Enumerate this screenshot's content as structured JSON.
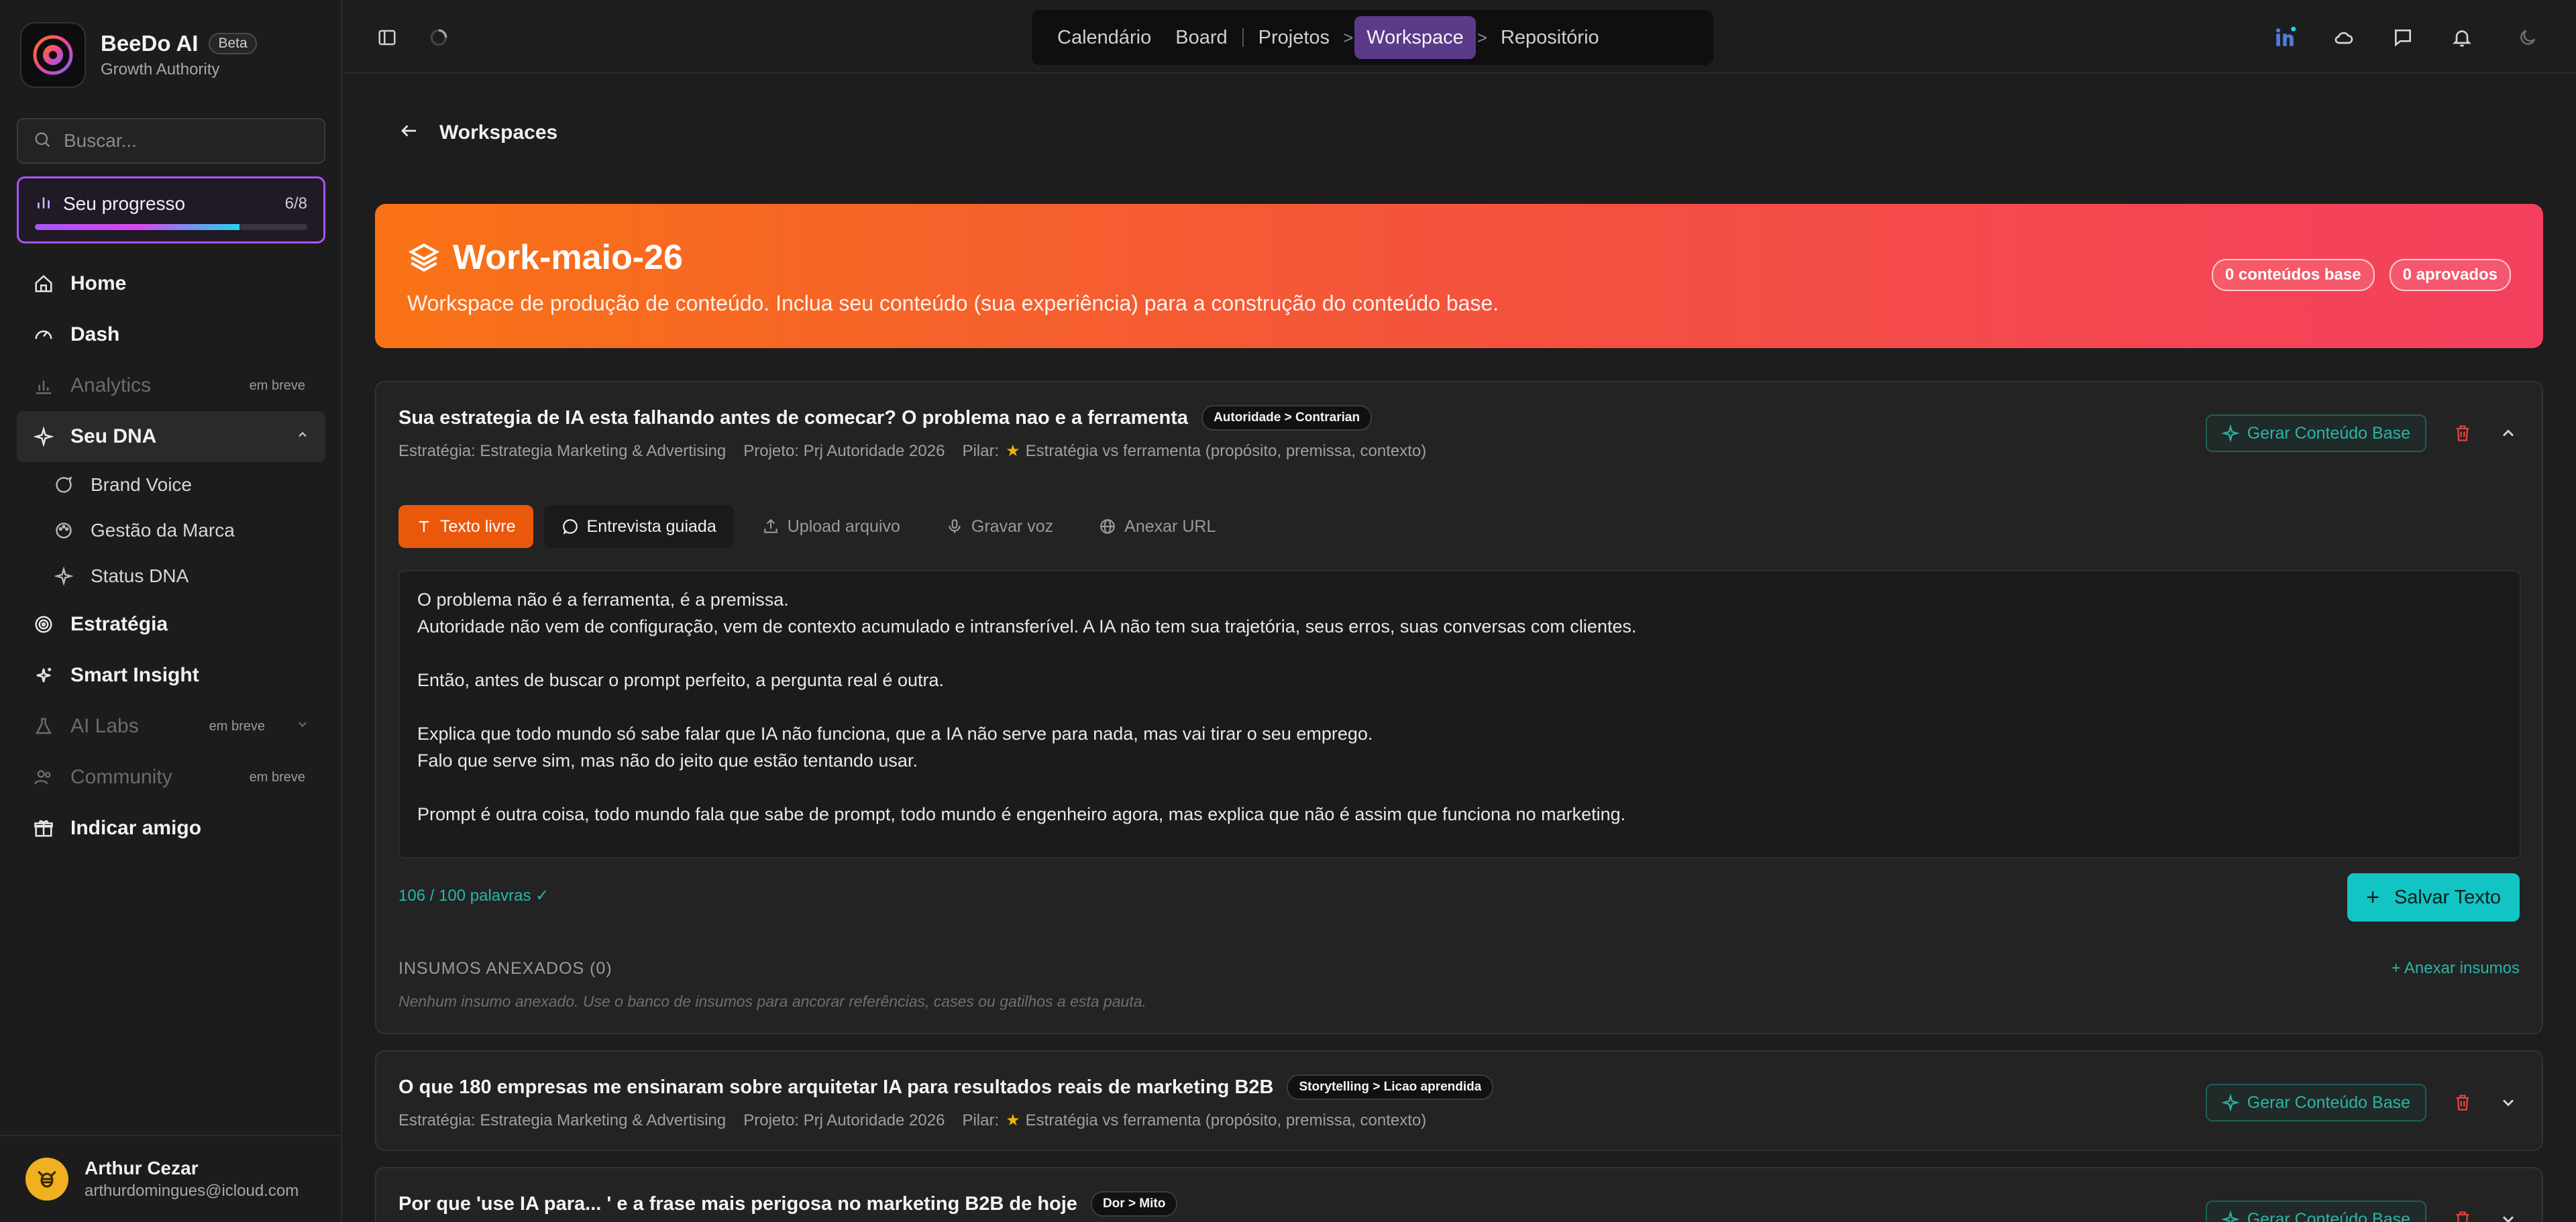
{
  "brand": {
    "name": "BeeDo AI",
    "badge": "Beta",
    "subtitle": "Growth Authority"
  },
  "search": {
    "placeholder": "Buscar..."
  },
  "progress": {
    "label": "Seu progresso",
    "count": "6/8",
    "value": 0.75
  },
  "nav": {
    "home": "Home",
    "dash": "Dash",
    "analytics": "Analytics",
    "analytics_soon": "em breve",
    "dna": "Seu DNA",
    "dna_items": [
      "Brand Voice",
      "Gestão da Marca",
      "Status DNA"
    ],
    "estrategia": "Estratégia",
    "smart_insight": "Smart Insight",
    "ai_labs": "AI Labs",
    "ai_labs_soon": "em breve",
    "community": "Community",
    "community_soon": "em breve",
    "indicar": "Indicar amigo"
  },
  "user": {
    "name": "Arthur Cezar",
    "email": "arthurdomingues@icloud.com"
  },
  "topnav": {
    "calendario": "Calendário",
    "board": "Board",
    "projetos": "Projetos",
    "workspace": "Workspace",
    "repositorio": "Repositório",
    "sep": ">"
  },
  "page": {
    "back_title": "Workspaces"
  },
  "hero": {
    "title": "Work-maio-26",
    "subtitle": "Workspace de produção de conteúdo. Inclua seu conteúdo (sua experiência) para a construção do conteúdo base.",
    "pill1": "0 conteúdos base",
    "pill2": "0 aprovados"
  },
  "cards": [
    {
      "title": "Sua estrategia de IA esta falhando antes de comecar? O problema nao e a ferramenta",
      "tag": "Autoridade > Contrarian",
      "estrategia": "Estratégia: Estrategia Marketing & Advertising",
      "projeto": "Projeto: Prj Autoridade 2026",
      "pilar_label": "Pilar:",
      "pilar": "Estratégia vs ferramenta (propósito, premissa, contexto)",
      "generate": "Gerar Conteúdo Base"
    },
    {
      "title": "O que 180 empresas me ensinaram sobre arquitetar IA para resultados reais de marketing B2B",
      "tag": "Storytelling > Licao aprendida",
      "estrategia": "Estratégia: Estrategia Marketing & Advertising",
      "projeto": "Projeto: Prj Autoridade 2026",
      "pilar_label": "Pilar:",
      "pilar": "Estratégia vs ferramenta (propósito, premissa, contexto)",
      "generate": "Gerar Conteúdo Base"
    },
    {
      "title": "Por que 'use IA para... ' e a frase mais perigosa no marketing B2B de hoje",
      "tag": "Dor > Mito",
      "generate": "Gerar Conteúdo Base"
    }
  ],
  "editor": {
    "tabs": [
      "Texto livre",
      "Entrevista guiada",
      "Upload arquivo",
      "Gravar voz",
      "Anexar URL"
    ],
    "text": "O problema não é a ferramenta, é a premissa.\nAutoridade não vem de configuração, vem de contexto acumulado e intransferível. A IA não tem sua trajetória, seus erros, suas conversas com clientes.\n\nEntão, antes de buscar o prompt perfeito, a pergunta real é outra.\n\nExplica que todo mundo só sabe falar que IA não funciona, que a IA não serve para nada, mas vai tirar o seu emprego.\nFalo que serve sim, mas não do jeito que estão tentando usar.\n\nPrompt é outra coisa, todo mundo fala que sabe de prompt, todo mundo é engenheiro agora, mas explica que não é assim que funciona no marketing.",
    "word_count": "106 / 100 palavras ✓",
    "save": "Salvar Texto"
  },
  "insumos": {
    "title": "INSUMOS ANEXADOS (0)",
    "link": "Anexar insumos",
    "empty": "Nenhum insumo anexado. Use o banco de insumos para ancorar referências, cases ou gatilhos a esta pauta."
  },
  "colors": {
    "accent_purple": "#a855f7",
    "orange": "#ea580c",
    "teal": "#12c4c4",
    "hero_start": "#f97316",
    "hero_end": "#f43f5e"
  }
}
